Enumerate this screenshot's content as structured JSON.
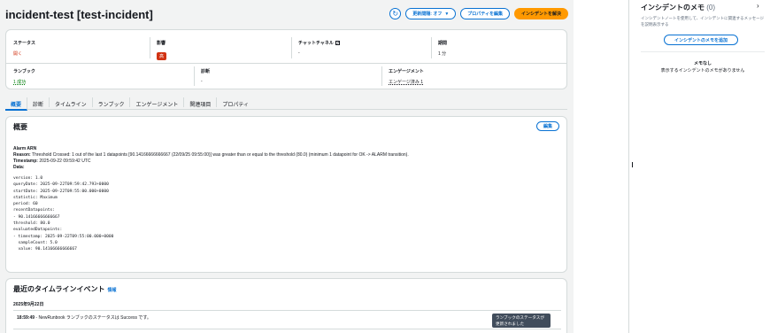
{
  "header": {
    "title": "incident-test [test-incident]",
    "update_label": "更新間隔: オフ",
    "edit_properties": "プロパティを編集",
    "resolve": "インシデントを解決"
  },
  "summary": {
    "status_label": "ステータス",
    "status_value": "開く",
    "impact_label": "影響",
    "impact_value": "高",
    "chat_label": "チャットチャネル",
    "chat_value": "-",
    "duration_label": "期間",
    "duration_value": "1 分",
    "runbook_label": "ランブック",
    "runbook_value": "1 成功",
    "diagnosis_label": "診断",
    "diagnosis_value": "-",
    "engagement_label": "エンゲージメント",
    "engagement_value": "エンゲージ済み 1"
  },
  "tabs": [
    "概要",
    "診断",
    "タイムライン",
    "ランブック",
    "エンゲージメント",
    "関連項目",
    "プロパティ"
  ],
  "overview": {
    "title": "概要",
    "edit": "編集",
    "alarm_arn_label": "Alarm ARN",
    "reason_label": "Reason:",
    "reason_text": "Threshold Crossed: 1 out of the last 1 datapoints [90.14166666666667 (22/09/25 09:55:00)] was greater than or equal to the threshold (80.0) (minimum 1 datapoint for OK -> ALARM transition).",
    "timestamp_label": "Timestamp:",
    "timestamp_value": "2025-09-22 09:59:42 UTC",
    "data_label": "Data:",
    "data_text": "version: 1.0\nqueryDate: 2025-09-22T09:59:42.793+0000\nstartDate: 2025-09-22T09:55:00.000+0000\nstatistic: Maximum\nperiod: 60\nrecentDatapoints:\n- 90.14166666666667\nthreshold: 80.0\nevaluatedDatapoints:\n- timestamp: 2025-09-22T09:55:00.000+0000\n  sampleCount: 5.0\n  value: 90.14166666666667"
  },
  "timeline": {
    "title": "最近のタイムラインイベント",
    "info": "情報",
    "date": "2025年9月22日",
    "event_time": "18:59:49",
    "event_sep": " - ",
    "event_text": "NewRunbook ランブックのステータスは Success です。",
    "event_badge": "ランブックのステータスが更新されました"
  },
  "notes": {
    "title": "インシデントのメモ",
    "count": "(0)",
    "description": "インシデントノートを使用して、インシデントに関連するメッセージを説明表示する",
    "add_button": "インシデントのメモを追加",
    "empty_title": "メモなし",
    "empty_desc": "表示するインシデントのメモがありません"
  },
  "icons": {
    "refresh": "refresh-icon",
    "dropdown": "caret-down-icon",
    "external": "external-link-icon",
    "collapse": "chevron-right-icon"
  }
}
